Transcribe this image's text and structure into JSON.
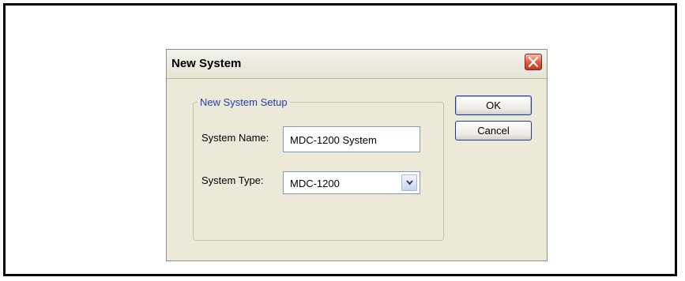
{
  "dialog": {
    "title": "New System",
    "group_title": "New System Setup",
    "system_name": {
      "label": "System Name:",
      "value": "MDC-1200 System"
    },
    "system_type": {
      "label": "System Type:",
      "selected": "MDC-1200"
    },
    "buttons": {
      "ok": "OK",
      "cancel": "Cancel"
    },
    "icons": {
      "close": "close-icon",
      "dropdown": "chevron-down-icon"
    }
  },
  "colors": {
    "dialog_bg": "#ece9d8",
    "group_title": "#1a3fb8",
    "close_button": "#e2573a"
  }
}
